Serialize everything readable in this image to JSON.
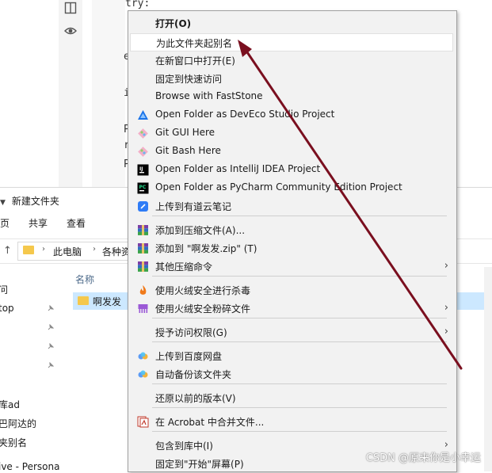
{
  "editor": {
    "lines": [
      "try:",
      "e",
      "i",
      "P",
      "r",
      "P"
    ]
  },
  "explorer": {
    "title": "新建文件夹",
    "ribbon_tabs": [
      "页",
      "共享",
      "查看"
    ],
    "breadcrumb": [
      "此电脑",
      "各种资"
    ],
    "column_name": "名称",
    "selected_item": "啊发发",
    "nav_items": [
      "问",
      "top",
      "库ad",
      "巴阿达的",
      "夹别名",
      "ive - Persona"
    ]
  },
  "context_menu": {
    "items": [
      {
        "label": "打开(O)",
        "bold": true,
        "icon": "",
        "submenu": false,
        "highlighted": false
      },
      {
        "label": "为此文件夹起别名",
        "bold": false,
        "icon": "",
        "submenu": false,
        "highlighted": true
      },
      {
        "label": "在新窗口中打开(E)",
        "bold": false,
        "icon": "",
        "submenu": false,
        "highlighted": false
      },
      {
        "label": "固定到快速访问",
        "bold": false,
        "icon": "",
        "submenu": false,
        "highlighted": false
      },
      {
        "label": "Browse with FastStone",
        "bold": false,
        "icon": "",
        "submenu": false,
        "highlighted": false
      },
      {
        "label": "Open Folder as DevEco Studio Project",
        "bold": false,
        "icon": "deveco-icon",
        "submenu": false,
        "highlighted": false
      },
      {
        "label": "Git GUI Here",
        "bold": false,
        "icon": "git-gui-icon",
        "submenu": false,
        "highlighted": false
      },
      {
        "label": "Git Bash Here",
        "bold": false,
        "icon": "git-bash-icon",
        "submenu": false,
        "highlighted": false
      },
      {
        "label": "Open Folder as IntelliJ IDEA Project",
        "bold": false,
        "icon": "intellij-icon",
        "submenu": false,
        "highlighted": false
      },
      {
        "label": "Open Folder as PyCharm Community Edition Project",
        "bold": false,
        "icon": "pycharm-icon",
        "submenu": false,
        "highlighted": false
      },
      {
        "label": "上传到有道云笔记",
        "bold": false,
        "icon": "youdao-note-icon",
        "submenu": false,
        "highlighted": false
      },
      {
        "label": "添加到压缩文件(A)...",
        "bold": false,
        "icon": "winrar-icon",
        "submenu": false,
        "highlighted": false
      },
      {
        "label": "添加到 \"啊发发.zip\" (T)",
        "bold": false,
        "icon": "winrar-icon",
        "submenu": false,
        "highlighted": false
      },
      {
        "label": "其他压缩命令",
        "bold": false,
        "icon": "winrar-icon",
        "submenu": true,
        "highlighted": false
      },
      {
        "label": "使用火绒安全进行杀毒",
        "bold": false,
        "icon": "huorong-scan-icon",
        "submenu": false,
        "highlighted": false
      },
      {
        "label": "使用火绒安全粉碎文件",
        "bold": false,
        "icon": "huorong-shred-icon",
        "submenu": true,
        "highlighted": false
      },
      {
        "label": "授予访问权限(G)",
        "bold": false,
        "icon": "",
        "submenu": true,
        "highlighted": false
      },
      {
        "label": "上传到百度网盘",
        "bold": false,
        "icon": "baidu-netdisk-icon",
        "submenu": false,
        "highlighted": false
      },
      {
        "label": "自动备份该文件夹",
        "bold": false,
        "icon": "baidu-netdisk-icon",
        "submenu": false,
        "highlighted": false
      },
      {
        "label": "还原以前的版本(V)",
        "bold": false,
        "icon": "",
        "submenu": false,
        "highlighted": false
      },
      {
        "label": "在 Acrobat 中合并文件...",
        "bold": false,
        "icon": "acrobat-icon",
        "submenu": false,
        "highlighted": false
      },
      {
        "label": "包含到库中(I)",
        "bold": false,
        "icon": "",
        "submenu": true,
        "highlighted": false
      },
      {
        "label": "固定到\"开始\"屏幕(P)",
        "bold": false,
        "icon": "",
        "submenu": false,
        "highlighted": false
      }
    ]
  },
  "annotation": {
    "arrow_color": "#7a0f1f"
  },
  "watermark": "CSDN @原来你是小幸运"
}
